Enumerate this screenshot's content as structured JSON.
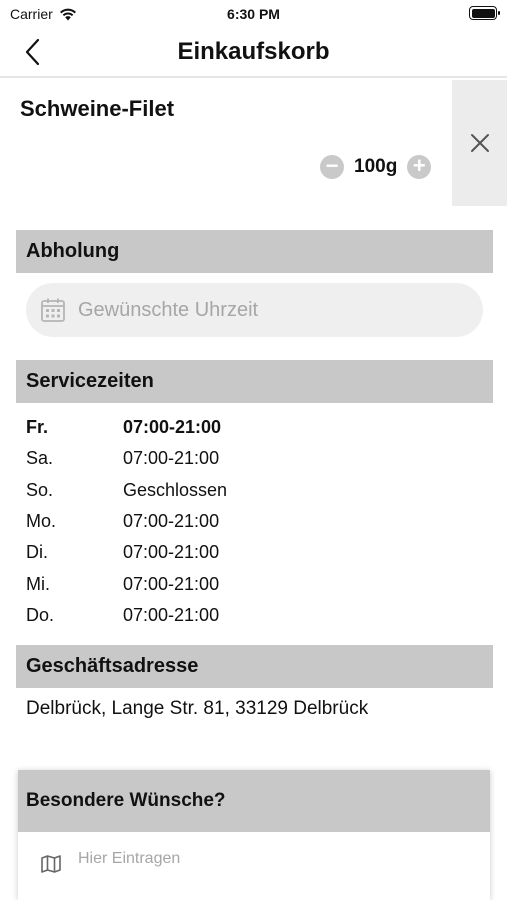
{
  "status_bar": {
    "carrier": "Carrier",
    "time": "6:30 PM"
  },
  "nav": {
    "title": "Einkaufskorb",
    "back_icon": "chevron-left-icon"
  },
  "cart_item": {
    "name": "Schweine-Filet",
    "quantity": "100g",
    "decrease_icon": "minus-circle-icon",
    "increase_icon": "plus-circle-icon",
    "remove_icon": "close-icon"
  },
  "pickup": {
    "header": "Abholung",
    "time_placeholder": "Gewünschte Uhrzeit",
    "calendar_icon": "calendar-icon"
  },
  "service_hours": {
    "header": "Servicezeiten",
    "rows": [
      {
        "day": "Fr.",
        "hours": "07:00-21:00"
      },
      {
        "day": "Sa.",
        "hours": "07:00-21:00"
      },
      {
        "day": "So.",
        "hours": "Geschlossen"
      },
      {
        "day": "Mo.",
        "hours": "07:00-21:00"
      },
      {
        "day": "Di.",
        "hours": "07:00-21:00"
      },
      {
        "day": "Mi.",
        "hours": "07:00-21:00"
      },
      {
        "day": "Do.",
        "hours": "07:00-21:00"
      }
    ]
  },
  "address": {
    "header": "Geschäftsadresse",
    "text": "Delbrück, Lange Str. 81, 33129 Delbrück"
  },
  "wishes": {
    "header": "Besondere Wünsche?",
    "placeholder": "Hier Eintragen",
    "map_icon": "map-icon"
  }
}
